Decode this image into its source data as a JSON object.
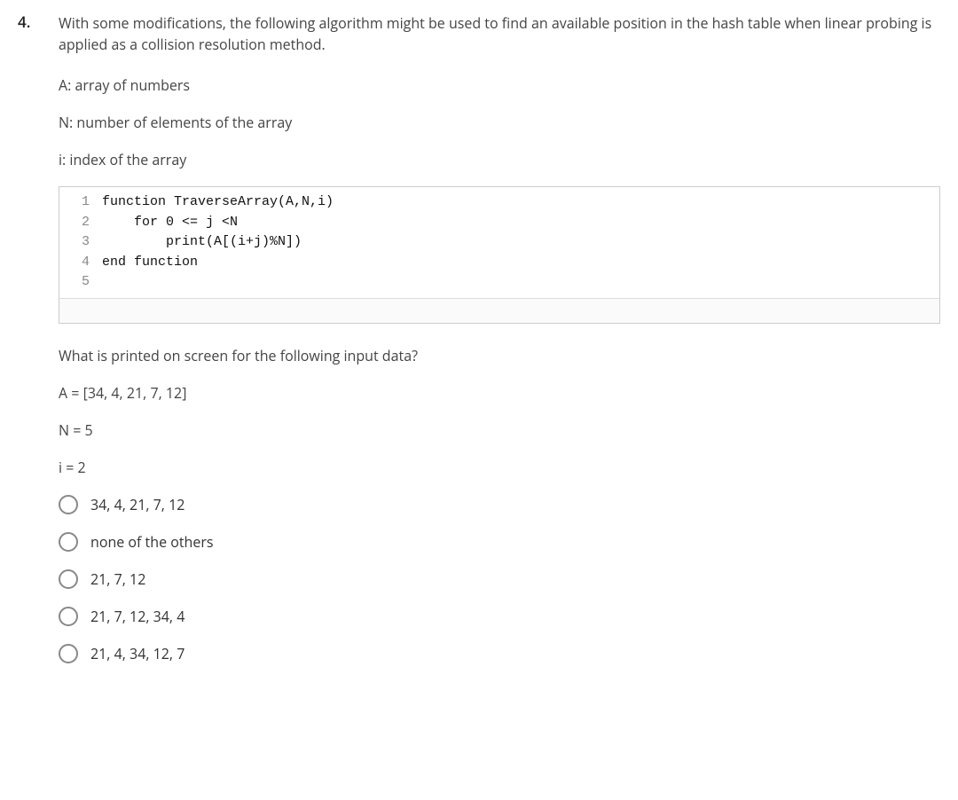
{
  "question_number": "4.",
  "intro": "With some modifications, the following algorithm might be used to find an available position in the hash table when linear probing is applied as a collision resolution method.",
  "defs": {
    "A": "A: array of numbers",
    "N": "N: number of elements of the array",
    "i": "i: index of the array"
  },
  "code": {
    "lines": [
      {
        "n": "1",
        "text": "function TraverseArray(A,N,i)"
      },
      {
        "n": "2",
        "text": "    for 0 <= j <N"
      },
      {
        "n": "3",
        "text": "        print(A[(i+j)%N])"
      },
      {
        "n": "4",
        "text": "end function"
      },
      {
        "n": "5",
        "text": ""
      }
    ]
  },
  "prompt": "What is printed on screen for the following input data?",
  "inputs": {
    "A": "A = [34, 4, 21, 7, 12]",
    "N": "N = 5",
    "i": "i = 2"
  },
  "options": [
    "34, 4, 21, 7, 12",
    "none of the others",
    "21, 7, 12",
    "21, 7, 12, 34, 4",
    "21, 4, 34, 12, 7"
  ]
}
